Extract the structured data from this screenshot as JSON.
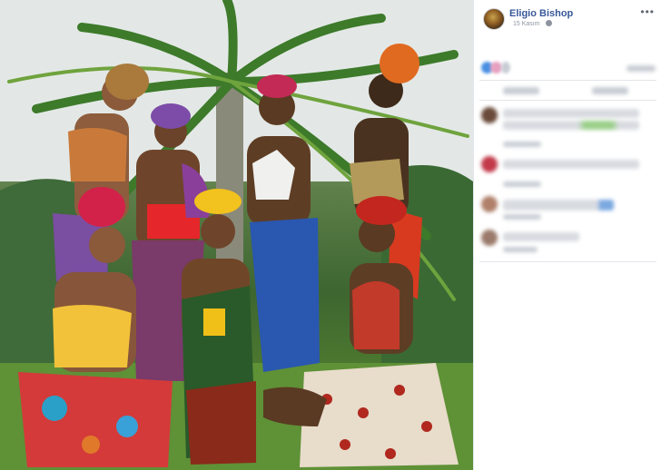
{
  "post": {
    "author_name": "Eligio Bishop",
    "date": "15 Kasım",
    "more_label": "•••"
  },
  "icons": {
    "privacy": "globe-icon",
    "menu": "more-options-icon"
  },
  "colors": {
    "author_link": "#385898",
    "meta_text": "#8d949e",
    "divider": "#e4e6eb"
  }
}
